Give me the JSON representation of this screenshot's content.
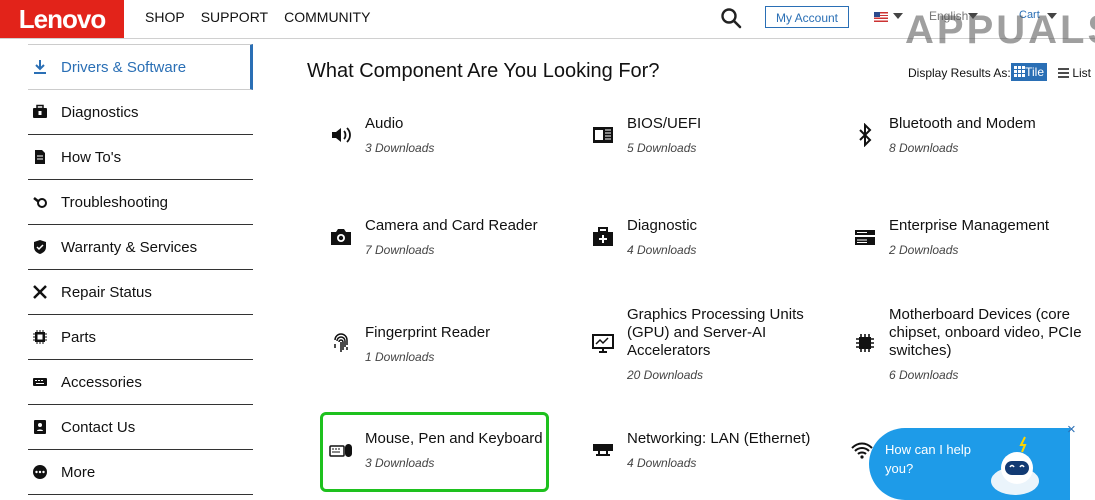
{
  "header": {
    "logo": "Lenovo",
    "nav": [
      "SHOP",
      "SUPPORT",
      "COMMUNITY"
    ],
    "my_account": "My Account",
    "language": "English",
    "cart": "Cart",
    "watermark": "APPUALS"
  },
  "sidebar": {
    "items": [
      {
        "label": "Drivers & Software",
        "icon": "download-icon",
        "active": true
      },
      {
        "label": "Diagnostics",
        "icon": "toolbox-icon"
      },
      {
        "label": "How To's",
        "icon": "document-icon"
      },
      {
        "label": "Troubleshooting",
        "icon": "wrench-gear-icon"
      },
      {
        "label": "Warranty & Services",
        "icon": "shield-icon"
      },
      {
        "label": "Repair Status",
        "icon": "tools-icon"
      },
      {
        "label": "Parts",
        "icon": "chip-icon"
      },
      {
        "label": "Accessories",
        "icon": "keyboard-icon"
      },
      {
        "label": "Contact Us",
        "icon": "contact-card-icon"
      },
      {
        "label": "More",
        "icon": "more-dots-icon"
      }
    ]
  },
  "main": {
    "title": "What Component Are You Looking For?",
    "display_as": "Display Results As:",
    "tile_label": "Tile",
    "list_label": "List",
    "components": [
      {
        "title": "Audio",
        "downloads": "3 Downloads",
        "icon": "speaker-icon"
      },
      {
        "title": "BIOS/UEFI",
        "downloads": "5 Downloads",
        "icon": "bios-chip-icon"
      },
      {
        "title": "Bluetooth and Modem",
        "downloads": "8 Downloads",
        "icon": "bluetooth-icon"
      },
      {
        "title": "Camera and Card Reader",
        "downloads": "7 Downloads",
        "icon": "camera-icon"
      },
      {
        "title": "Diagnostic",
        "downloads": "4 Downloads",
        "icon": "medkit-icon"
      },
      {
        "title": "Enterprise Management",
        "downloads": "2 Downloads",
        "icon": "server-icon"
      },
      {
        "title": "Fingerprint Reader",
        "downloads": "1 Downloads",
        "icon": "fingerprint-icon"
      },
      {
        "title": "Graphics Processing Units (GPU) and Server-AI Accelerators",
        "downloads": "20 Downloads",
        "icon": "monitor-icon"
      },
      {
        "title": "Motherboard Devices (core chipset, onboard video, PCIe switches)",
        "downloads": "6 Downloads",
        "icon": "cpu-icon"
      },
      {
        "title": "Mouse, Pen and Keyboard",
        "downloads": "3 Downloads",
        "icon": "mouse-keyboard-icon"
      },
      {
        "title": "Networking: LAN (Ethernet)",
        "downloads": "4 Downloads",
        "icon": "network-switch-icon"
      },
      {
        "title": "",
        "downloads": "",
        "icon": "wifi-icon"
      }
    ]
  },
  "chat": {
    "text": "How can I help you?",
    "close": "×"
  },
  "colors": {
    "brand": "#e2231a",
    "accent": "#2a6fb5",
    "highlight": "#1ec11e",
    "chat": "#1e9be8"
  }
}
